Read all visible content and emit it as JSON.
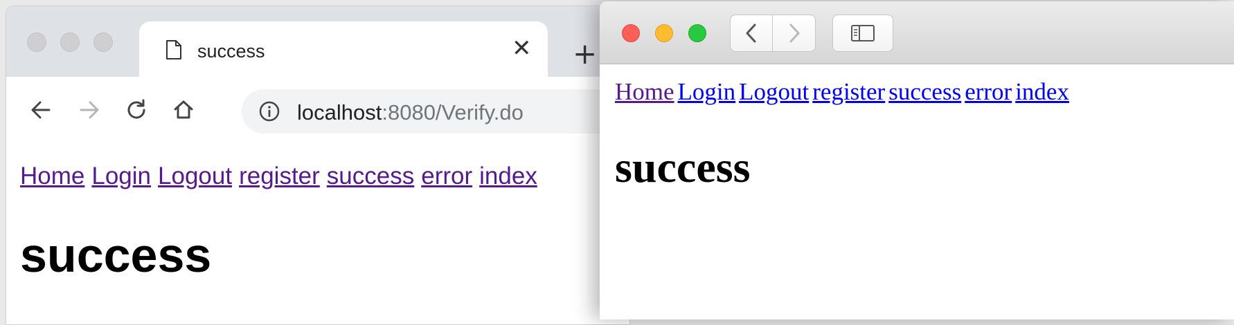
{
  "chrome": {
    "tab_title": "success",
    "url_host": "localhost",
    "url_rest": ":8080/Verify.do",
    "icons": {
      "page": "page-icon",
      "close": "close-icon",
      "new_tab": "plus-icon",
      "back": "arrow-left-icon",
      "forward": "arrow-right-icon",
      "reload": "reload-icon",
      "home": "home-icon",
      "info": "info-icon"
    },
    "content": {
      "links": [
        "Home",
        "Login",
        "Logout",
        "register",
        "success",
        "error",
        "index"
      ],
      "heading": "success"
    }
  },
  "safari": {
    "icons": {
      "back": "chevron-left-icon",
      "forward": "chevron-right-icon",
      "sidebar": "sidebar-icon"
    },
    "content": {
      "links": [
        "Home",
        "Login",
        "Logout",
        "register",
        "success",
        "error",
        "index"
      ],
      "heading": "success"
    }
  },
  "colors": {
    "link_visited": "#551a8b",
    "link_unvisited": "#0000ee",
    "traffic_red": "#fe5f57",
    "traffic_yellow": "#febc2e",
    "traffic_green": "#28c840"
  }
}
